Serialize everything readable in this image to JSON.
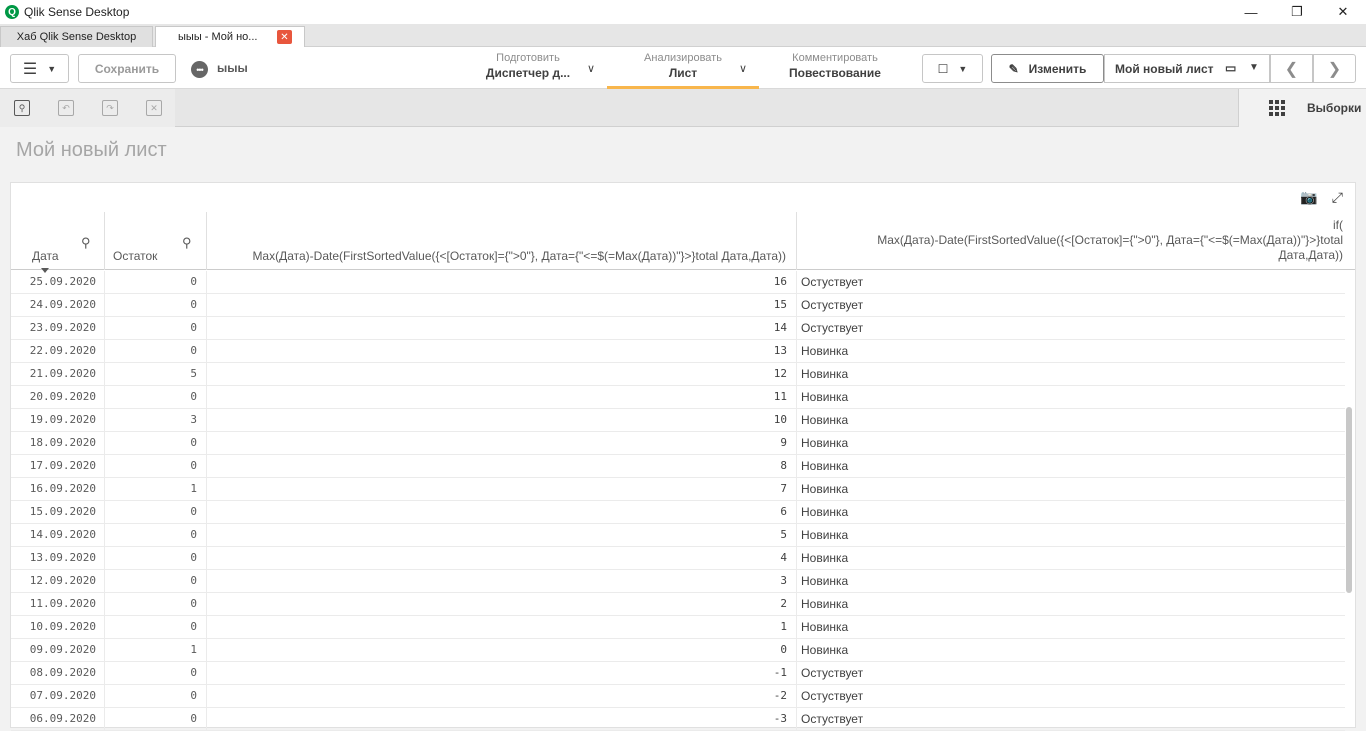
{
  "window": {
    "title": "Qlik Sense Desktop",
    "logo_text": "Q"
  },
  "tabs": [
    {
      "label": "Хаб Qlik Sense Desktop"
    },
    {
      "label": "ыыы - Мой но..."
    }
  ],
  "toolbar": {
    "save_label": "Сохранить",
    "app_icon": "•••",
    "app_name": "ыыы",
    "prepare": {
      "sub": "Подготовить",
      "main": "Диспетчер д..."
    },
    "analyze": {
      "sub": "Анализировать",
      "main": "Лист"
    },
    "narrate": {
      "sub": "Комментировать",
      "main": "Повествование"
    },
    "edit_label": "Изменить",
    "sheet_name": "Мой новый лист"
  },
  "selections": {
    "label": "Выборки"
  },
  "sheet": {
    "title": "Мой новый лист"
  },
  "table": {
    "headers": {
      "date": "Дата",
      "stock": "Остаток",
      "measure": "Max(Дата)-Date(FirstSortedValue({<[Остаток]={\">0\"}, Дата={\"<=$(=Max(Дата))\"}>}total Дата,Дата))",
      "status_line1": "if(",
      "status_line2": "Max(Дата)-Date(FirstSortedValue({<[Остаток]={\">0\"}, Дата={\"<=$(=Max(Дата))\"}>}total",
      "status_line3": "Дата,Дата))"
    },
    "rows": [
      {
        "date": "25.09.2020",
        "stock": "0",
        "diff": "16",
        "status": "Остуствует"
      },
      {
        "date": "24.09.2020",
        "stock": "0",
        "diff": "15",
        "status": "Остуствует"
      },
      {
        "date": "23.09.2020",
        "stock": "0",
        "diff": "14",
        "status": "Остуствует"
      },
      {
        "date": "22.09.2020",
        "stock": "0",
        "diff": "13",
        "status": "Новинка"
      },
      {
        "date": "21.09.2020",
        "stock": "5",
        "diff": "12",
        "status": "Новинка"
      },
      {
        "date": "20.09.2020",
        "stock": "0",
        "diff": "11",
        "status": "Новинка"
      },
      {
        "date": "19.09.2020",
        "stock": "3",
        "diff": "10",
        "status": "Новинка"
      },
      {
        "date": "18.09.2020",
        "stock": "0",
        "diff": "9",
        "status": "Новинка"
      },
      {
        "date": "17.09.2020",
        "stock": "0",
        "diff": "8",
        "status": "Новинка"
      },
      {
        "date": "16.09.2020",
        "stock": "1",
        "diff": "7",
        "status": "Новинка"
      },
      {
        "date": "15.09.2020",
        "stock": "0",
        "diff": "6",
        "status": "Новинка"
      },
      {
        "date": "14.09.2020",
        "stock": "0",
        "diff": "5",
        "status": "Новинка"
      },
      {
        "date": "13.09.2020",
        "stock": "0",
        "diff": "4",
        "status": "Новинка"
      },
      {
        "date": "12.09.2020",
        "stock": "0",
        "diff": "3",
        "status": "Новинка"
      },
      {
        "date": "11.09.2020",
        "stock": "0",
        "diff": "2",
        "status": "Новинка"
      },
      {
        "date": "10.09.2020",
        "stock": "0",
        "diff": "1",
        "status": "Новинка"
      },
      {
        "date": "09.09.2020",
        "stock": "1",
        "diff": "0",
        "status": "Новинка"
      },
      {
        "date": "08.09.2020",
        "stock": "0",
        "diff": "-1",
        "status": "Остуствует"
      },
      {
        "date": "07.09.2020",
        "stock": "0",
        "diff": "-2",
        "status": "Остуствует"
      },
      {
        "date": "06.09.2020",
        "stock": "0",
        "diff": "-3",
        "status": "Остуствует"
      }
    ]
  },
  "colors": {
    "brand": "#009845",
    "accent": "#f8b64c",
    "close": "#e8563d"
  },
  "icons": [
    "menu-icon",
    "app-icon",
    "bookmark-icon",
    "pencil-icon",
    "sheet-icon",
    "chevron-left-icon",
    "chevron-right-icon",
    "search-icon",
    "camera-icon",
    "expand-icon",
    "selections-icon"
  ]
}
